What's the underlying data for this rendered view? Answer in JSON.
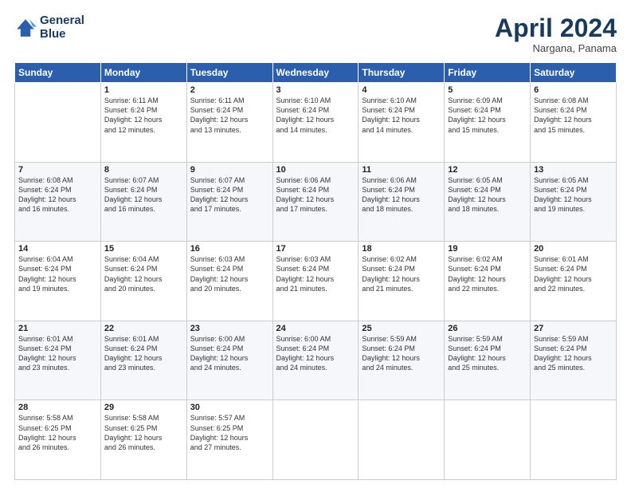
{
  "logo": {
    "line1": "General",
    "line2": "Blue"
  },
  "title": "April 2024",
  "location": "Nargana, Panama",
  "days_header": [
    "Sunday",
    "Monday",
    "Tuesday",
    "Wednesday",
    "Thursday",
    "Friday",
    "Saturday"
  ],
  "weeks": [
    [
      {
        "day": "",
        "info": ""
      },
      {
        "day": "1",
        "info": "Sunrise: 6:11 AM\nSunset: 6:24 PM\nDaylight: 12 hours\nand 12 minutes."
      },
      {
        "day": "2",
        "info": "Sunrise: 6:11 AM\nSunset: 6:24 PM\nDaylight: 12 hours\nand 13 minutes."
      },
      {
        "day": "3",
        "info": "Sunrise: 6:10 AM\nSunset: 6:24 PM\nDaylight: 12 hours\nand 14 minutes."
      },
      {
        "day": "4",
        "info": "Sunrise: 6:10 AM\nSunset: 6:24 PM\nDaylight: 12 hours\nand 14 minutes."
      },
      {
        "day": "5",
        "info": "Sunrise: 6:09 AM\nSunset: 6:24 PM\nDaylight: 12 hours\nand 15 minutes."
      },
      {
        "day": "6",
        "info": "Sunrise: 6:08 AM\nSunset: 6:24 PM\nDaylight: 12 hours\nand 15 minutes."
      }
    ],
    [
      {
        "day": "7",
        "info": "Sunrise: 6:08 AM\nSunset: 6:24 PM\nDaylight: 12 hours\nand 16 minutes."
      },
      {
        "day": "8",
        "info": "Sunrise: 6:07 AM\nSunset: 6:24 PM\nDaylight: 12 hours\nand 16 minutes."
      },
      {
        "day": "9",
        "info": "Sunrise: 6:07 AM\nSunset: 6:24 PM\nDaylight: 12 hours\nand 17 minutes."
      },
      {
        "day": "10",
        "info": "Sunrise: 6:06 AM\nSunset: 6:24 PM\nDaylight: 12 hours\nand 17 minutes."
      },
      {
        "day": "11",
        "info": "Sunrise: 6:06 AM\nSunset: 6:24 PM\nDaylight: 12 hours\nand 18 minutes."
      },
      {
        "day": "12",
        "info": "Sunrise: 6:05 AM\nSunset: 6:24 PM\nDaylight: 12 hours\nand 18 minutes."
      },
      {
        "day": "13",
        "info": "Sunrise: 6:05 AM\nSunset: 6:24 PM\nDaylight: 12 hours\nand 19 minutes."
      }
    ],
    [
      {
        "day": "14",
        "info": "Sunrise: 6:04 AM\nSunset: 6:24 PM\nDaylight: 12 hours\nand 19 minutes."
      },
      {
        "day": "15",
        "info": "Sunrise: 6:04 AM\nSunset: 6:24 PM\nDaylight: 12 hours\nand 20 minutes."
      },
      {
        "day": "16",
        "info": "Sunrise: 6:03 AM\nSunset: 6:24 PM\nDaylight: 12 hours\nand 20 minutes."
      },
      {
        "day": "17",
        "info": "Sunrise: 6:03 AM\nSunset: 6:24 PM\nDaylight: 12 hours\nand 21 minutes."
      },
      {
        "day": "18",
        "info": "Sunrise: 6:02 AM\nSunset: 6:24 PM\nDaylight: 12 hours\nand 21 minutes."
      },
      {
        "day": "19",
        "info": "Sunrise: 6:02 AM\nSunset: 6:24 PM\nDaylight: 12 hours\nand 22 minutes."
      },
      {
        "day": "20",
        "info": "Sunrise: 6:01 AM\nSunset: 6:24 PM\nDaylight: 12 hours\nand 22 minutes."
      }
    ],
    [
      {
        "day": "21",
        "info": "Sunrise: 6:01 AM\nSunset: 6:24 PM\nDaylight: 12 hours\nand 23 minutes."
      },
      {
        "day": "22",
        "info": "Sunrise: 6:01 AM\nSunset: 6:24 PM\nDaylight: 12 hours\nand 23 minutes."
      },
      {
        "day": "23",
        "info": "Sunrise: 6:00 AM\nSunset: 6:24 PM\nDaylight: 12 hours\nand 24 minutes."
      },
      {
        "day": "24",
        "info": "Sunrise: 6:00 AM\nSunset: 6:24 PM\nDaylight: 12 hours\nand 24 minutes."
      },
      {
        "day": "25",
        "info": "Sunrise: 5:59 AM\nSunset: 6:24 PM\nDaylight: 12 hours\nand 24 minutes."
      },
      {
        "day": "26",
        "info": "Sunrise: 5:59 AM\nSunset: 6:24 PM\nDaylight: 12 hours\nand 25 minutes."
      },
      {
        "day": "27",
        "info": "Sunrise: 5:59 AM\nSunset: 6:24 PM\nDaylight: 12 hours\nand 25 minutes."
      }
    ],
    [
      {
        "day": "28",
        "info": "Sunrise: 5:58 AM\nSunset: 6:25 PM\nDaylight: 12 hours\nand 26 minutes."
      },
      {
        "day": "29",
        "info": "Sunrise: 5:58 AM\nSunset: 6:25 PM\nDaylight: 12 hours\nand 26 minutes."
      },
      {
        "day": "30",
        "info": "Sunrise: 5:57 AM\nSunset: 6:25 PM\nDaylight: 12 hours\nand 27 minutes."
      },
      {
        "day": "",
        "info": ""
      },
      {
        "day": "",
        "info": ""
      },
      {
        "day": "",
        "info": ""
      },
      {
        "day": "",
        "info": ""
      }
    ]
  ]
}
